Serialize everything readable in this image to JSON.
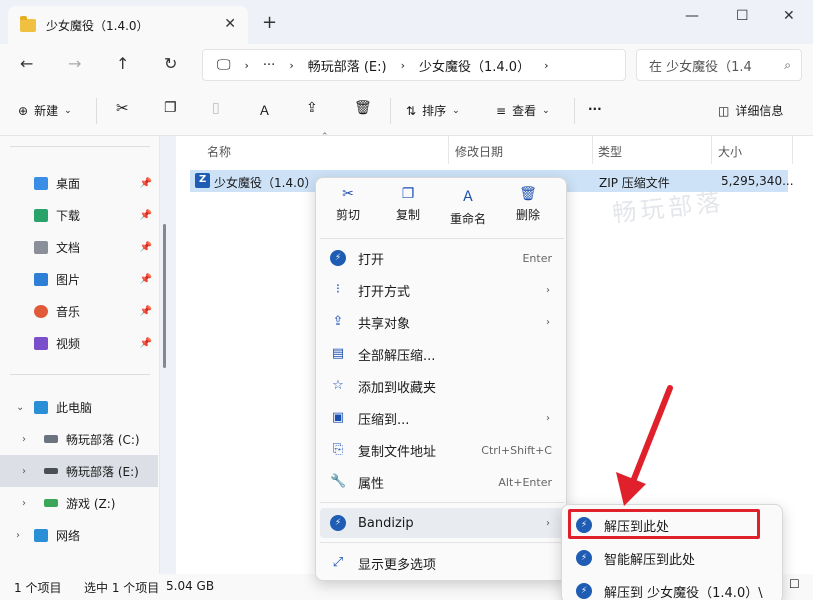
{
  "window": {
    "tab_title": "少女魔役（1.4.0）",
    "tab_close": "✕",
    "new_tab": "+",
    "minimize": "—",
    "maximize": "☐",
    "close": "✕"
  },
  "nav": {
    "back": "←",
    "forward": "→",
    "up": "↑",
    "refresh": "↻",
    "breadcrumb_more": "···",
    "breadcrumb": [
      "畅玩部落 (E:)",
      "少女魔役（1.4.0）"
    ],
    "search_placeholder": "在 少女魔役（1.4"
  },
  "toolbar": {
    "new_label": "新建",
    "sort_label": "排序",
    "view_label": "查看",
    "more_label": "···",
    "details_label": "详细信息"
  },
  "sidebar": {
    "quick": [
      {
        "label": "桌面",
        "icon": "desktop-icon",
        "color": "#3a8ee6"
      },
      {
        "label": "下载",
        "icon": "download-icon",
        "color": "#2aa36b"
      },
      {
        "label": "文档",
        "icon": "document-icon",
        "color": "#8a8f99"
      },
      {
        "label": "图片",
        "icon": "picture-icon",
        "color": "#2f7fd6"
      },
      {
        "label": "音乐",
        "icon": "music-icon",
        "color": "#e05a3a"
      },
      {
        "label": "视频",
        "icon": "video-icon",
        "color": "#7b4fc9"
      }
    ],
    "this_pc": "此电脑",
    "drives": [
      {
        "label": "畅玩部落 (C:)",
        "selected": false
      },
      {
        "label": "畅玩部落 (E:)",
        "selected": true
      },
      {
        "label": "游戏 (Z:)",
        "selected": false
      }
    ],
    "network": "网络"
  },
  "columns": {
    "name": "名称",
    "modified": "修改日期",
    "type": "类型",
    "size": "大小"
  },
  "file": {
    "name": "少女魔役（1.4.0）",
    "type": "ZIP 压缩文件",
    "size": "5,295,340..."
  },
  "watermark": "畅玩部落",
  "status": {
    "count": "1 个项目",
    "selected": "选中 1 个项目",
    "size": "5.04 GB"
  },
  "context_menu": {
    "actions": [
      {
        "label": "剪切",
        "icon": "scissors-icon",
        "glyph": "✂"
      },
      {
        "label": "复制",
        "icon": "copy-icon",
        "glyph": "❐"
      },
      {
        "label": "重命名",
        "icon": "rename-icon",
        "glyph": "Ａ"
      },
      {
        "label": "删除",
        "icon": "trash-icon",
        "glyph": "🗑"
      }
    ],
    "items": [
      {
        "label": "打开",
        "shortcut": "Enter",
        "icon": "bandizip-icon",
        "arrow": ""
      },
      {
        "label": "打开方式",
        "shortcut": "",
        "icon": "open-with-icon",
        "arrow": "›"
      },
      {
        "label": "共享对象",
        "shortcut": "",
        "icon": "share-icon",
        "arrow": "›"
      },
      {
        "label": "全部解压缩...",
        "shortcut": "",
        "icon": "extract-all-icon",
        "arrow": ""
      },
      {
        "label": "添加到收藏夹",
        "shortcut": "",
        "icon": "star-icon",
        "arrow": ""
      },
      {
        "label": "压缩到...",
        "shortcut": "",
        "icon": "compress-icon",
        "arrow": "›"
      },
      {
        "label": "复制文件地址",
        "shortcut": "Ctrl+Shift+C",
        "icon": "copy-path-icon",
        "arrow": ""
      },
      {
        "label": "属性",
        "shortcut": "Alt+Enter",
        "icon": "wrench-icon",
        "arrow": ""
      }
    ],
    "bandizip": {
      "label": "Bandizip",
      "arrow": "›"
    },
    "more_options": "显示更多选项"
  },
  "submenu": {
    "items": [
      {
        "label": "解压到此处"
      },
      {
        "label": "智能解压到此处"
      },
      {
        "label": "解压到 少女魔役（1.4.0）\\"
      }
    ],
    "highlight_color": "#e0202a"
  }
}
